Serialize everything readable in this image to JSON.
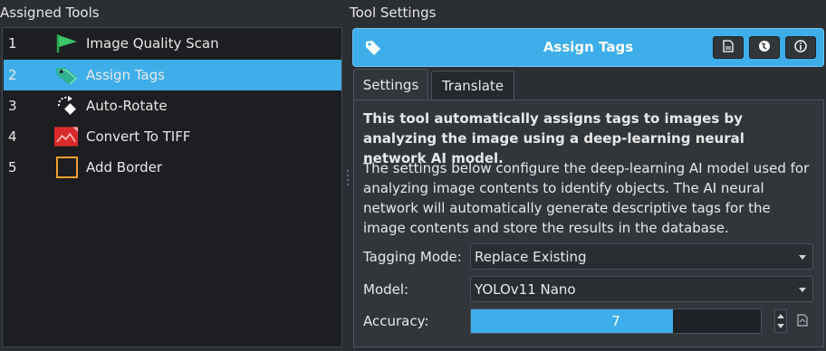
{
  "left_panel": {
    "title": "Assigned Tools",
    "items": [
      {
        "num": "1",
        "label": "Image Quality Scan",
        "icon": "flag-icon"
      },
      {
        "num": "2",
        "label": "Assign Tags",
        "icon": "tags-icon",
        "selected": true
      },
      {
        "num": "3",
        "label": "Auto-Rotate",
        "icon": "rotate-icon"
      },
      {
        "num": "4",
        "label": "Convert To TIFF",
        "icon": "image-file-icon"
      },
      {
        "num": "5",
        "label": "Add Border",
        "icon": "border-icon"
      }
    ]
  },
  "right_panel": {
    "title": "Tool Settings",
    "header": {
      "title": "Assign Tags",
      "icon": "tag-icon",
      "buttons": [
        "document-icon",
        "globe-icon",
        "info-icon"
      ]
    },
    "tabs": [
      {
        "label": "Settings",
        "active": true
      },
      {
        "label": "Translate",
        "active": false
      }
    ],
    "description_bold": "This tool automatically assigns tags to images by analyzing the image using a deep-learning neural network AI model.",
    "description": "The settings below configure the deep-learning AI model used for analyzing image contents to identify objects. The AI neural network will automatically generate descriptive tags for the image contents and store the results in the database.",
    "fields": {
      "tagging_mode": {
        "label": "Tagging Mode:",
        "value": "Replace Existing"
      },
      "model": {
        "label": "Model:",
        "value": "YOLOv11 Nano"
      },
      "accuracy": {
        "label": "Accuracy:",
        "value": "7",
        "fill_fraction": 0.697
      }
    }
  },
  "colors": {
    "accent": "#3daee9",
    "background": "#2b2e33",
    "panel": "#31363b",
    "list_background": "#1c1e21"
  }
}
